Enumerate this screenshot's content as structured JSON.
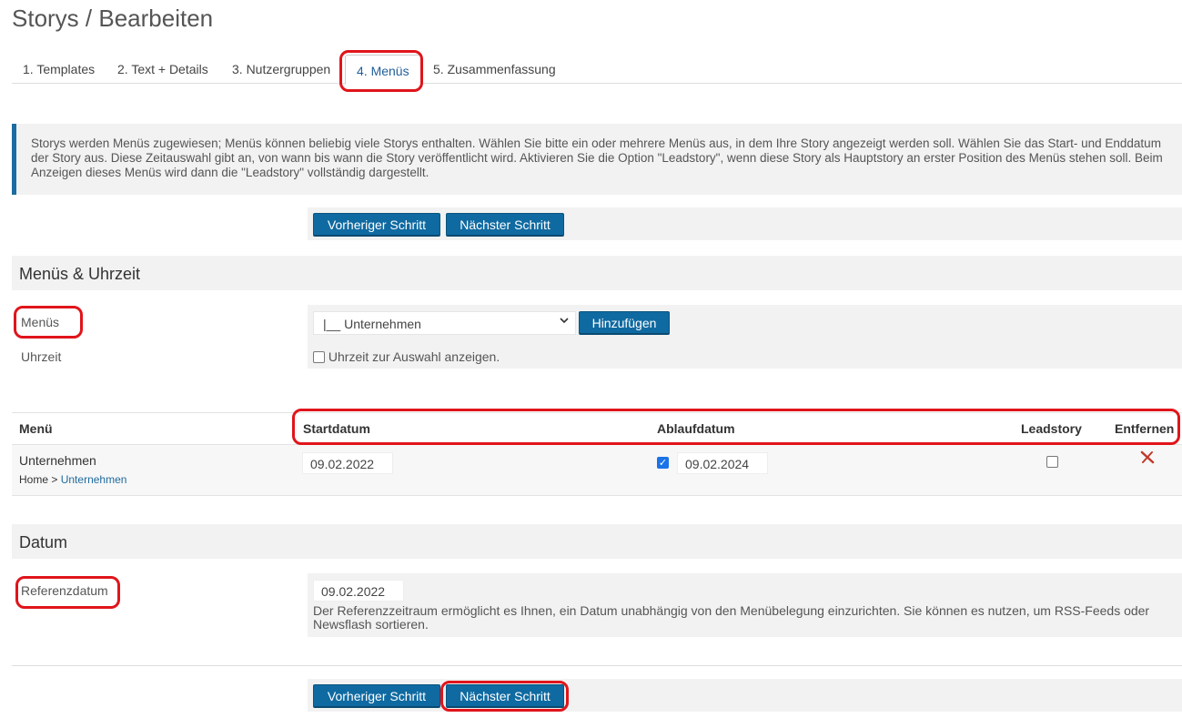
{
  "page_title": "Storys / Bearbeiten",
  "tabs": [
    {
      "label": "1. Templates"
    },
    {
      "label": "2. Text + Details"
    },
    {
      "label": "3. Nutzergruppen"
    },
    {
      "label": "4. Menüs"
    },
    {
      "label": "5. Zusammenfassung"
    }
  ],
  "active_tab": "4. Menüs",
  "info_text": "Storys werden Menüs zugewiesen; Menüs können beliebig viele Storys enthalten. Wählen Sie bitte ein oder mehrere Menüs aus, in dem Ihre Story angezeigt werden soll. Wählen Sie das Start- und Enddatum der Story aus. Diese Zeitauswahl gibt an, von wann bis wann die Story veröffentlicht wird. Aktivieren Sie die Option \"Leadstory\", wenn diese Story als Hauptstory an erster Position des Menüs stehen soll. Beim Anzeigen dieses Menüs wird dann die \"Leadstory\" vollständig dargestellt.",
  "buttons": {
    "prev": "Vorheriger Schritt",
    "next": "Nächster Schritt",
    "add": "Hinzufügen"
  },
  "section_menus": {
    "heading": "Menüs & Uhrzeit",
    "menus_label": "Menüs",
    "menu_select_value": "|__ Unternehmen",
    "time_label": "Uhrzeit",
    "time_checkbox_label": "Uhrzeit zur Auswahl anzeigen.",
    "time_checkbox_checked": false
  },
  "table": {
    "headers": {
      "menu": "Menü",
      "start": "Startdatum",
      "end": "Ablaufdatum",
      "lead": "Leadstory",
      "remove": "Entfernen"
    },
    "rows": [
      {
        "menu": "Unternehmen",
        "breadcrumb_home": "Home",
        "breadcrumb_sep": ">",
        "breadcrumb_link": "Unternehmen",
        "start": "09.02.2022",
        "end_enabled": true,
        "end": "09.02.2024",
        "lead": false
      }
    ]
  },
  "section_date": {
    "heading": "Datum",
    "ref_label": "Referenzdatum",
    "ref_value": "09.02.2022",
    "ref_help": "Der Referenzzeitraum ermöglicht es Ihnen, ein Datum unabhängig von den Menübelegung einzurichten. Sie können es nutzen, um RSS-Feeds oder Newsflash sortieren."
  },
  "colors": {
    "accent": "#0f6aa1",
    "highlight": "#e0151b",
    "remove_icon": "#c0392b"
  },
  "icons": {
    "select_chevron": "chevron-down-icon",
    "remove": "remove-x-icon"
  }
}
